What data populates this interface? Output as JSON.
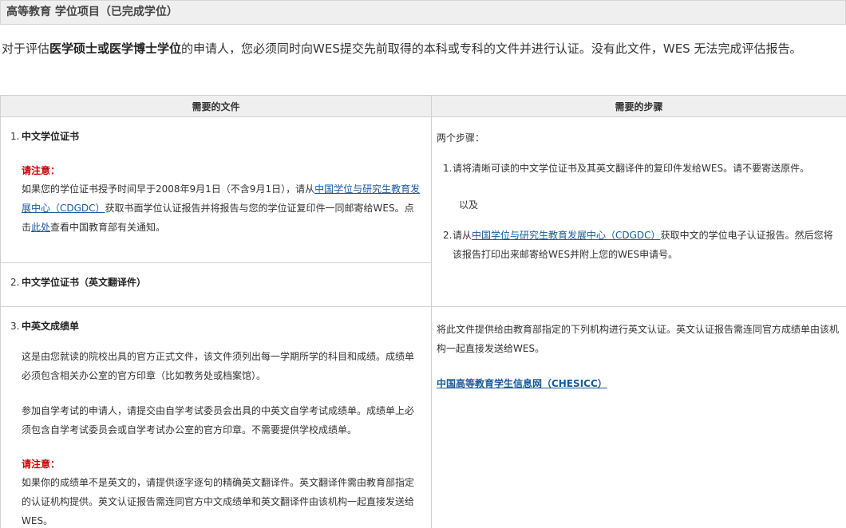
{
  "section_title": "高等教育 学位项目（已完成学位）",
  "intro": {
    "prefix": "对于评估",
    "bold": "医学硕士或医学博士学位",
    "suffix": "的申请人，您必须同时向WES提交先前取得的本科或专科的文件并进行认证。没有此文件，WES 无法完成评估报告。"
  },
  "table": {
    "headers": [
      "需要的文件",
      "需要的步骤"
    ],
    "item1": {
      "num": "1.",
      "title": "中文学位证书",
      "note_label": "请注意：",
      "text_before_link": "如果您的学位证书授予时间早于2008年9月1日（不含9月1日），请从",
      "link1": "中国学位与研究生教育发展中心（CDGDC）",
      "text_after_link": "获取书面学位认证报告并将报告与您的学位证复印件一同邮寄给WES。点击",
      "link2": "此处",
      "text_end": "查看中国教育部有关通知。"
    },
    "item2": {
      "num": "2.",
      "title": "中文学位证书（英文翻译件）"
    },
    "steps_block": {
      "intro": "两个步骤：",
      "step1_num": "1.",
      "step1": "请将清晰可读的中文学位证书及其英文翻译件的复印件发给WES。请不要寄送原件。",
      "and": "以及",
      "step2_num": "2.",
      "step2_before": "请从",
      "step2_link": "中国学位与研究生教育发展中心（CDGDC）",
      "step2_after": "获取中文的学位电子认证报告。然后您将该报告打印出来邮寄给WES并附上您的WES申请号。"
    },
    "item3": {
      "num": "3.",
      "title": "中英文成绩单",
      "para1": "这是由您就读的院校出具的官方正式文件，该文件须列出每一学期所学的科目和成绩。成绩单必须包含相关办公室的官方印章（比如教务处或档案馆）。",
      "para2": "参加自学考试的申请人，请提交由自学考试委员会出具的中英文自学考试成绩单。成绩单上必须包含自学考试委员会或自学考试办公室的官方印章。不需要提供学校成绩单。",
      "note_label": "请注意：",
      "para3": "如果你的成绩单不是英文的，请提供逐字逐句的精确英文翻译件。英文翻译件需由教育部指定的认证机构提供。英文认证报告需连同官方中文成绩单和英文翻译件由该机构一起直接发送给WES。"
    },
    "item3_steps": {
      "text": "将此文件提供给由教育部指定的下列机构进行英文认证。英文认证报告需连同官方成绩单由该机构一起直接发送给WES。",
      "link": "中国高等教育学生信息网（CHESICC）"
    }
  }
}
